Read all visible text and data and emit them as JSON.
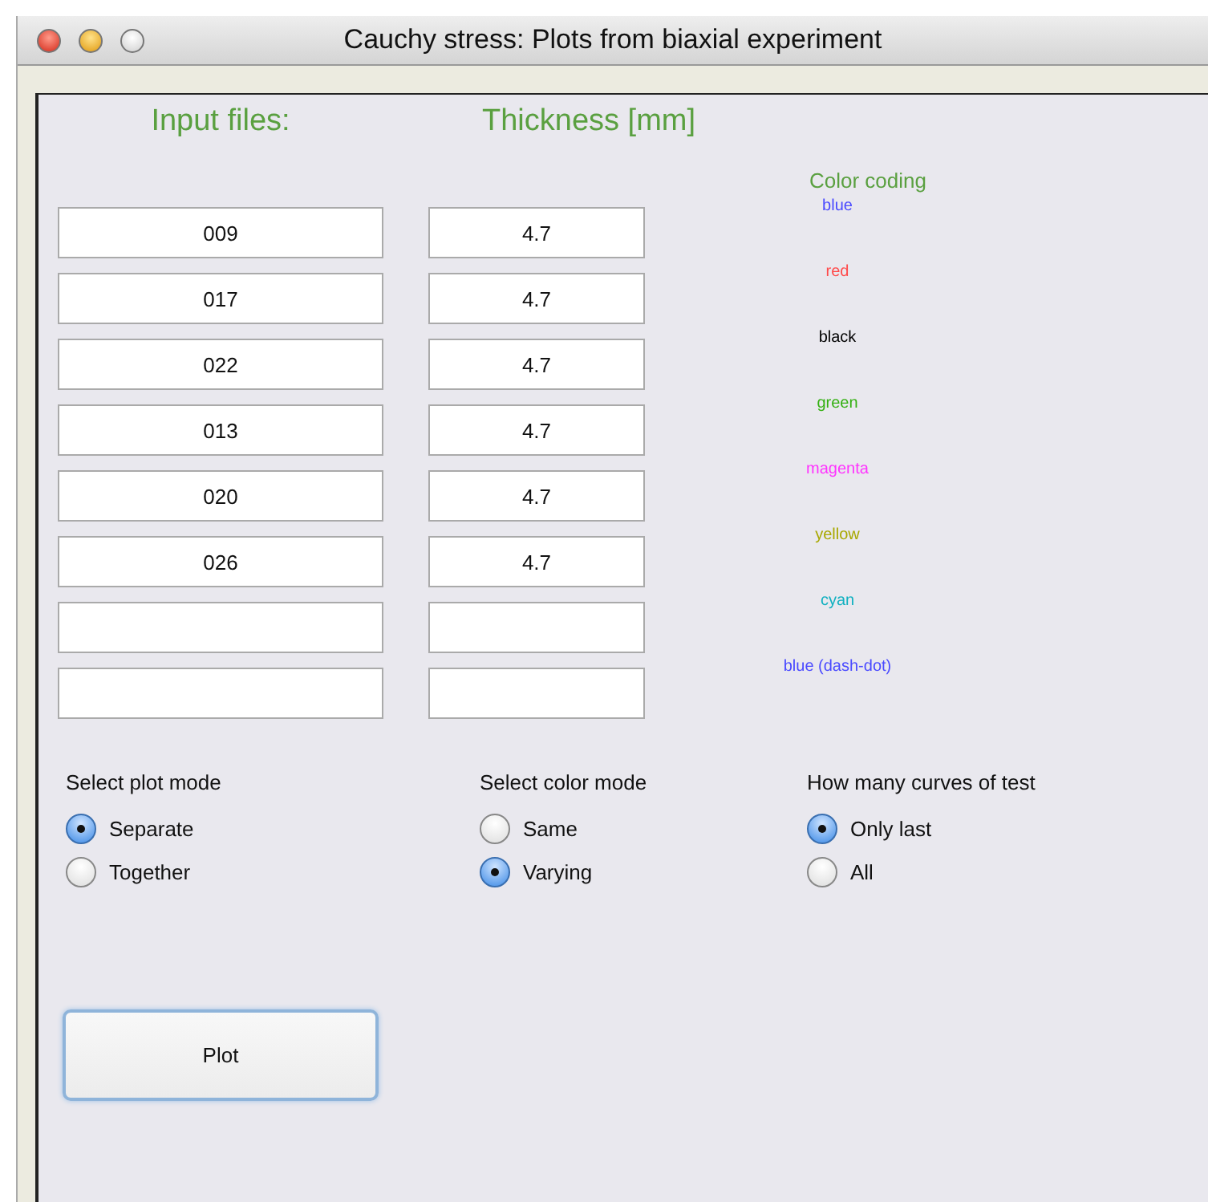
{
  "window": {
    "title": "Cauchy stress: Plots from biaxial experiment"
  },
  "headers": {
    "files": "Input files:",
    "thickness": "Thickness [mm]",
    "color_coding": "Color coding"
  },
  "rows": [
    {
      "file": "009",
      "thickness": "4.7",
      "color_label": "blue",
      "color": "#4a4aff"
    },
    {
      "file": "017",
      "thickness": "4.7",
      "color_label": "red",
      "color": "#ff4a4a"
    },
    {
      "file": "022",
      "thickness": "4.7",
      "color_label": "black",
      "color": "#000000"
    },
    {
      "file": "013",
      "thickness": "4.7",
      "color_label": "green",
      "color": "#33b011"
    },
    {
      "file": "020",
      "thickness": "4.7",
      "color_label": "magenta",
      "color": "#ff33ff"
    },
    {
      "file": "026",
      "thickness": "4.7",
      "color_label": "yellow",
      "color": "#a8a800"
    },
    {
      "color_label": "cyan",
      "color": "#10b0c0"
    },
    {
      "color_label": "blue (dash-dot)",
      "color": "#4a4aff"
    }
  ],
  "groups": [
    {
      "title": "Select plot mode",
      "options": [
        {
          "label": "Separate",
          "selected": true
        },
        {
          "label": "Together",
          "selected": false
        }
      ]
    },
    {
      "title": "Select color mode",
      "options": [
        {
          "label": "Same",
          "selected": false
        },
        {
          "label": "Varying",
          "selected": true
        }
      ]
    },
    {
      "title": "How many curves of test",
      "options": [
        {
          "label": "Only last",
          "selected": true
        },
        {
          "label": "All",
          "selected": false
        }
      ]
    }
  ],
  "plot_button": "Plot"
}
